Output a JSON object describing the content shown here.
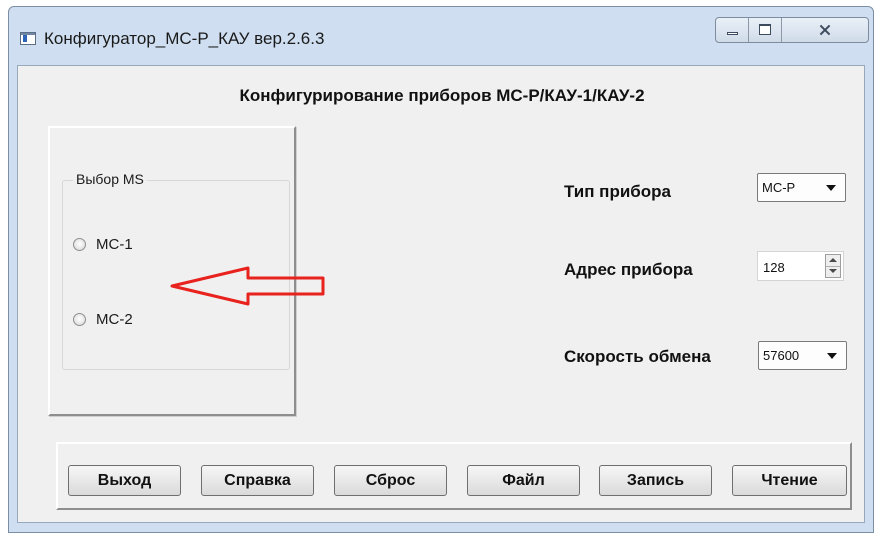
{
  "window": {
    "title": "Конфигуратор_МС-Р_КАУ вер.2.6.3",
    "controls": {
      "minimize": "minimize-icon",
      "maximize": "maximize-icon",
      "close": "close-icon"
    }
  },
  "header": {
    "title": "Конфигурирование приборов МС-Р/КАУ-1/КАУ-2"
  },
  "ms_group": {
    "label": "Выбор MS",
    "options": [
      {
        "label": "МС-1",
        "checked": false
      },
      {
        "label": "МС-2",
        "checked": false
      }
    ]
  },
  "annotation": {
    "arrow_color": "#e8221d"
  },
  "device_type": {
    "label": "Тип прибора",
    "value": "МС-Р"
  },
  "device_address": {
    "label": "Адрес прибора",
    "value": "128"
  },
  "baud_rate": {
    "label": "Скорость обмена",
    "value": "57600"
  },
  "buttons": {
    "exit": "Выход",
    "help": "Справка",
    "reset": "Сброс",
    "file": "Файл",
    "write": "Запись",
    "read": "Чтение"
  }
}
